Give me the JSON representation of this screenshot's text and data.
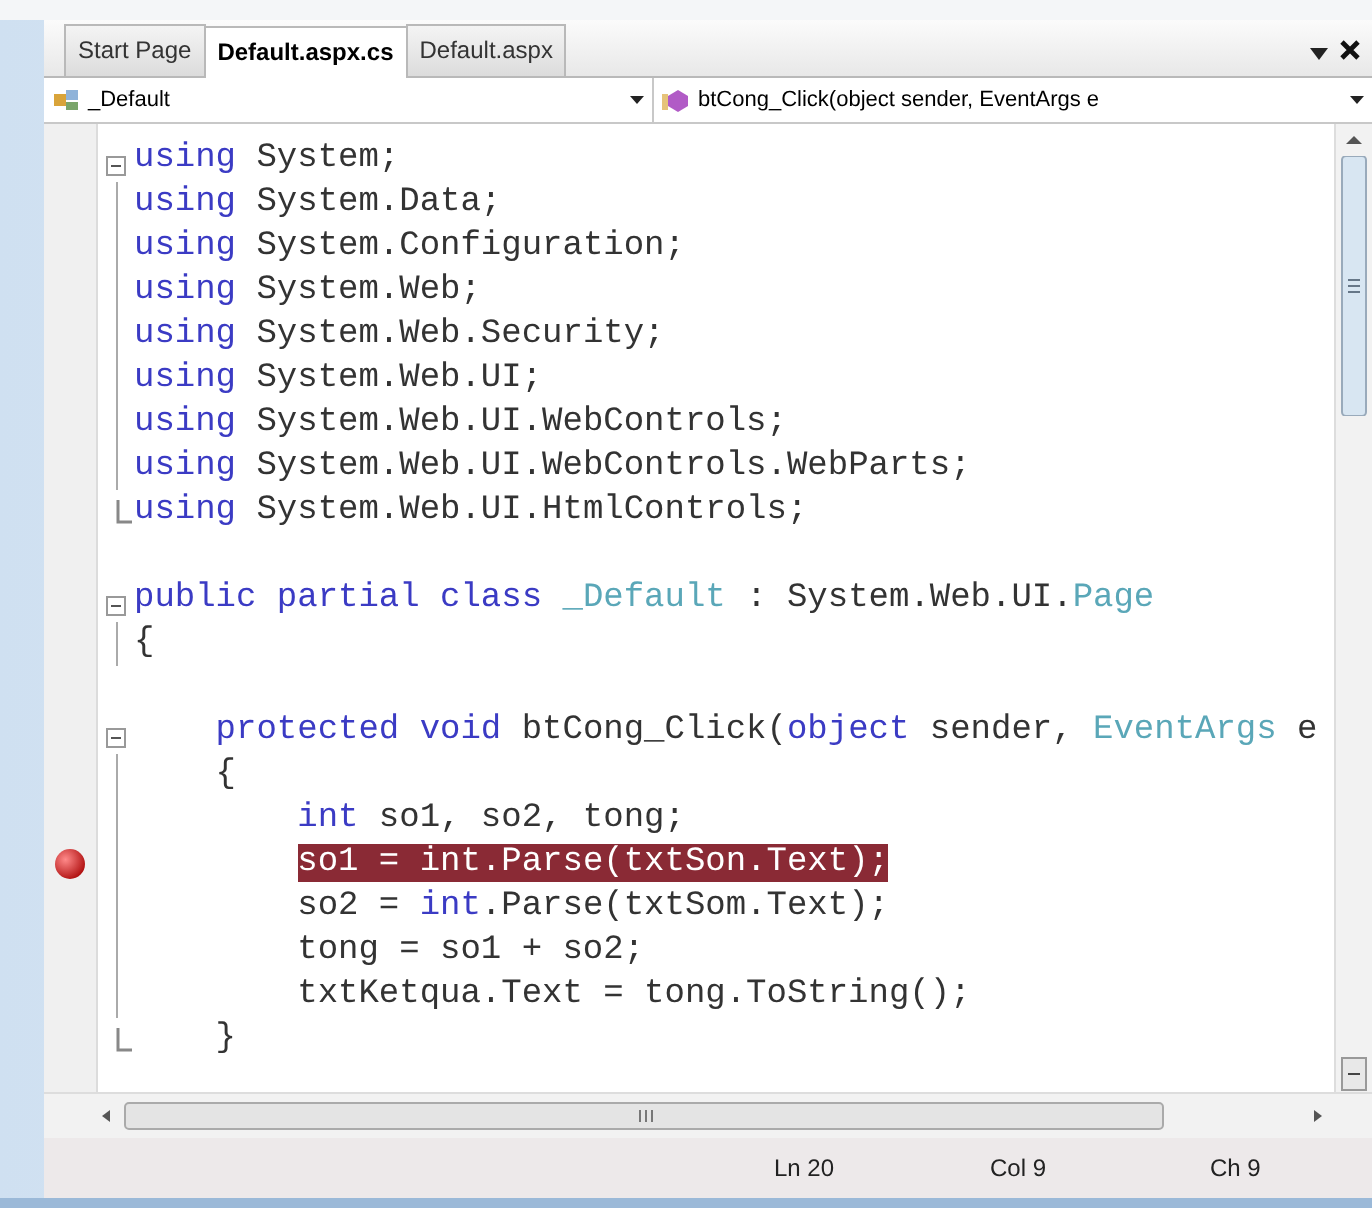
{
  "tabs": [
    {
      "label": "Start Page",
      "selected": false
    },
    {
      "label": "Default.aspx.cs",
      "selected": true
    },
    {
      "label": "Default.aspx",
      "selected": false
    }
  ],
  "navigation": {
    "class_dropdown": "_Default",
    "member_dropdown": "btCong_Click(object sender, EventArgs e"
  },
  "code_lines": [
    {
      "kind": "code",
      "fold_start": true,
      "fold_end": false,
      "breakpoint": false,
      "tokens": [
        {
          "text": "using",
          "kind": "keyword"
        },
        {
          "text": " System;",
          "kind": "plain"
        }
      ]
    },
    {
      "kind": "code",
      "fold_start": false,
      "fold_end": false,
      "breakpoint": false,
      "tokens": [
        {
          "text": "using",
          "kind": "keyword"
        },
        {
          "text": " System.Data;",
          "kind": "plain"
        }
      ]
    },
    {
      "kind": "code",
      "fold_start": false,
      "fold_end": false,
      "breakpoint": false,
      "tokens": [
        {
          "text": "using",
          "kind": "keyword"
        },
        {
          "text": " System.Configuration;",
          "kind": "plain"
        }
      ]
    },
    {
      "kind": "code",
      "fold_start": false,
      "fold_end": false,
      "breakpoint": false,
      "tokens": [
        {
          "text": "using",
          "kind": "keyword"
        },
        {
          "text": " System.Web;",
          "kind": "plain"
        }
      ]
    },
    {
      "kind": "code",
      "fold_start": false,
      "fold_end": false,
      "breakpoint": false,
      "tokens": [
        {
          "text": "using",
          "kind": "keyword"
        },
        {
          "text": " System.Web.Security;",
          "kind": "plain"
        }
      ]
    },
    {
      "kind": "code",
      "fold_start": false,
      "fold_end": false,
      "breakpoint": false,
      "tokens": [
        {
          "text": "using",
          "kind": "keyword"
        },
        {
          "text": " System.Web.UI;",
          "kind": "plain"
        }
      ]
    },
    {
      "kind": "code",
      "fold_start": false,
      "fold_end": false,
      "breakpoint": false,
      "tokens": [
        {
          "text": "using",
          "kind": "keyword"
        },
        {
          "text": " System.Web.UI.WebControls;",
          "kind": "plain"
        }
      ]
    },
    {
      "kind": "code",
      "fold_start": false,
      "fold_end": false,
      "breakpoint": false,
      "tokens": [
        {
          "text": "using",
          "kind": "keyword"
        },
        {
          "text": " System.Web.UI.WebControls.WebParts;",
          "kind": "plain"
        }
      ]
    },
    {
      "kind": "code",
      "fold_start": false,
      "fold_end": true,
      "breakpoint": false,
      "tokens": [
        {
          "text": "using",
          "kind": "keyword"
        },
        {
          "text": " System.Web.UI.HtmlControls;",
          "kind": "plain"
        }
      ]
    },
    {
      "kind": "blank"
    },
    {
      "kind": "code",
      "fold_start": true,
      "fold_end": false,
      "breakpoint": false,
      "tokens": [
        {
          "text": "public partial class",
          "kind": "keyword"
        },
        {
          "text": " _Default",
          "kind": "type"
        },
        {
          "text": " : System.Web.UI.",
          "kind": "plain"
        },
        {
          "text": "Page",
          "kind": "type"
        }
      ]
    },
    {
      "kind": "code",
      "fold_start": false,
      "fold_end": false,
      "breakpoint": false,
      "tokens": [
        {
          "text": "{",
          "kind": "plain"
        }
      ]
    },
    {
      "kind": "blank"
    },
    {
      "kind": "code",
      "fold_start": true,
      "fold_end": false,
      "breakpoint": false,
      "tokens": [
        {
          "text": "    protected void",
          "kind": "keyword"
        },
        {
          "text": " btCong_Click(",
          "kind": "plain"
        },
        {
          "text": "object",
          "kind": "keyword"
        },
        {
          "text": " sender, ",
          "kind": "plain"
        },
        {
          "text": "EventArgs",
          "kind": "type"
        },
        {
          "text": " e",
          "kind": "plain"
        }
      ]
    },
    {
      "kind": "code",
      "fold_start": false,
      "fold_end": false,
      "breakpoint": false,
      "tokens": [
        {
          "text": "    {",
          "kind": "plain"
        }
      ]
    },
    {
      "kind": "code",
      "fold_start": false,
      "fold_end": false,
      "breakpoint": false,
      "tokens": [
        {
          "text": "        int",
          "kind": "keyword"
        },
        {
          "text": " so1, so2, tong;",
          "kind": "plain"
        }
      ]
    },
    {
      "kind": "code",
      "fold_start": false,
      "fold_end": false,
      "breakpoint": true,
      "tokens": [
        {
          "text": "        so1 = int.Parse(txtSon.Text);",
          "kind": "breakpoint"
        }
      ]
    },
    {
      "kind": "code",
      "fold_start": false,
      "fold_end": false,
      "breakpoint": false,
      "tokens": [
        {
          "text": "        so2 = ",
          "kind": "plain"
        },
        {
          "text": "int",
          "kind": "keyword"
        },
        {
          "text": ".Parse(txtSom.Text);",
          "kind": "plain"
        }
      ]
    },
    {
      "kind": "code",
      "fold_start": false,
      "fold_end": false,
      "breakpoint": false,
      "tokens": [
        {
          "text": "        tong = so1 + so2;",
          "kind": "plain"
        }
      ]
    },
    {
      "kind": "code",
      "fold_start": false,
      "fold_end": false,
      "breakpoint": false,
      "tokens": [
        {
          "text": "        txtKetqua.Text = tong.ToString();",
          "kind": "plain"
        }
      ]
    },
    {
      "kind": "code",
      "fold_start": false,
      "fold_end": true,
      "breakpoint": false,
      "tokens": [
        {
          "text": "    }",
          "kind": "plain"
        }
      ]
    }
  ],
  "status_bar": {
    "line": "Ln 20",
    "column": "Col 9",
    "char": "Ch 9"
  }
}
